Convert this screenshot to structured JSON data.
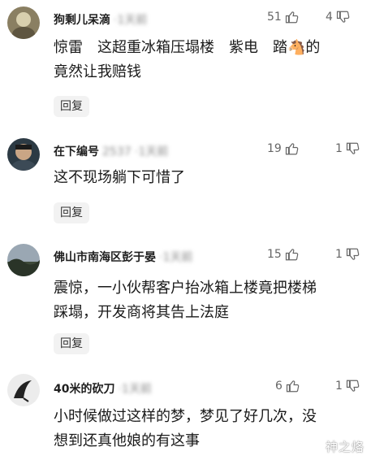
{
  "comments": [
    {
      "username": "狗剩儿呆滴",
      "blurred_meta": "·1天前",
      "likes": "51",
      "dislikes": "4",
      "text": "惊雷　这超重冰箱压塌楼　紫电　踏🐴的\n竟然让我赔钱",
      "reply_label": "回复"
    },
    {
      "username": "在下编号",
      "blurred_meta": "2537 ·1天前",
      "likes": "19",
      "dislikes": "1",
      "text": "这不现场躺下可惜了",
      "reply_label": "回复"
    },
    {
      "username": "佛山市南海区彭于晏",
      "blurred_meta": "·1天前",
      "likes": "15",
      "dislikes": "1",
      "text": "震惊，一小伙帮客户抬冰箱上楼竟把楼梯\n踩塌，开发商将其告上法庭",
      "reply_label": "回复"
    },
    {
      "username": "40米的砍刀",
      "blurred_meta": "·1天前",
      "likes": "6",
      "dislikes": "1",
      "text": "小时候做过这样的梦，梦见了好几次，没\n想到还真他娘的有这事",
      "reply_label": ""
    }
  ],
  "watermark": "神之烙",
  "icons": {
    "like": "thumbs-up-icon",
    "dislike": "thumbs-down-icon"
  }
}
